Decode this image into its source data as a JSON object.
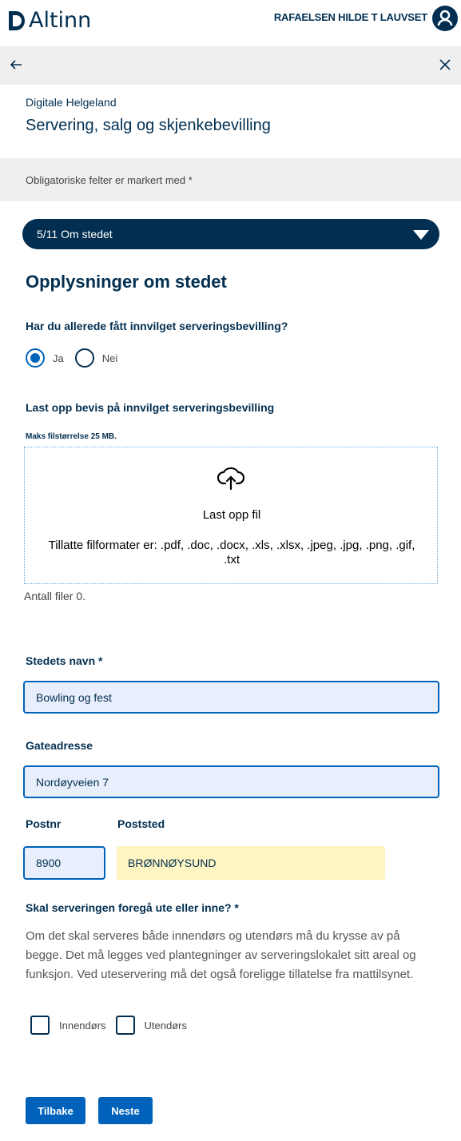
{
  "header": {
    "brand": "Altinn",
    "user_name": "RAFAELSEN HILDE T LAUVSET",
    "brand_color": "#022f51"
  },
  "form": {
    "organization": "Digitale Helgeland",
    "title": "Servering, salg og skjenkebevilling",
    "required_note": "Obligatoriske felter er markert med *",
    "navigation": {
      "current": "5/11 Om stedet"
    },
    "section_title": "Opplysninger om stedet",
    "serving_license": {
      "question": "Har du allerede fått innvilget serveringsbevilling?",
      "options": [
        {
          "label": "Ja",
          "selected": true
        },
        {
          "label": "Nei",
          "selected": false
        }
      ]
    },
    "upload": {
      "label": "Last opp bevis på innvilget serveringsbevilling",
      "max_size": "Maks filstørrelse 25 MB.",
      "dropzone_title": "Last opp fil",
      "allowed_formats": "Tillatte filformater er: .pdf, .doc, .docx, .xls, .xlsx, .jpeg, .jpg, .png, .gif, .txt",
      "file_count": "Antall filer 0."
    },
    "place_name": {
      "label": "Stedets navn *",
      "value": "Bowling og fest"
    },
    "street_address": {
      "label": "Gateadresse",
      "value": "Nordøyveien 7"
    },
    "postal_code": {
      "label": "Postnr",
      "value": "8900"
    },
    "postal_place": {
      "label": "Poststed",
      "value": "BRØNNØYSUND"
    },
    "location": {
      "question": "Skal serveringen foregå ute eller inne? *",
      "description": "Om det skal serveres både innendørs og utendørs må du krysse av på begge. Det må legges ved plantegninger av serveringslokalet sitt areal og funksjon. Ved uteservering må det også foreligge tillatelse fra mattilsynet.",
      "options": [
        {
          "label": "Innendørs",
          "checked": false
        },
        {
          "label": "Utendørs",
          "checked": false
        }
      ]
    },
    "buttons": {
      "back": "Tilbake",
      "next": "Neste"
    }
  }
}
